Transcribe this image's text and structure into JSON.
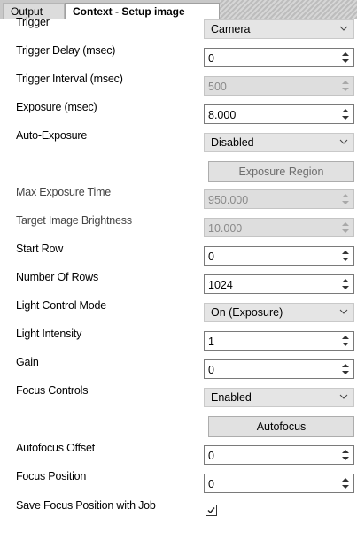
{
  "tabs": {
    "output": "Output",
    "context": "Context - Setup image"
  },
  "fields": {
    "trigger": {
      "label": "Trigger",
      "value": "Camera"
    },
    "trigger_delay": {
      "label": "Trigger Delay (msec)",
      "value": "0"
    },
    "trigger_interval": {
      "label": "Trigger Interval (msec)",
      "value": "500"
    },
    "exposure": {
      "label": "Exposure (msec)",
      "value": "8.000"
    },
    "auto_exposure": {
      "label": "Auto-Exposure",
      "value": "Disabled"
    },
    "exposure_region": {
      "button": "Exposure Region"
    },
    "max_exposure_time": {
      "label": "Max Exposure Time",
      "value": "950.000"
    },
    "target_brightness": {
      "label": "Target Image Brightness",
      "value": "10.000"
    },
    "start_row": {
      "label": "Start Row",
      "value": "0"
    },
    "number_of_rows": {
      "label": "Number Of Rows",
      "value": "1024"
    },
    "light_control_mode": {
      "label": "Light Control Mode",
      "value": "On (Exposure)"
    },
    "light_intensity": {
      "label": "Light Intensity",
      "value": "1"
    },
    "gain": {
      "label": "Gain",
      "value": "0"
    },
    "focus_controls": {
      "label": "Focus Controls",
      "value": "Enabled"
    },
    "autofocus": {
      "button": "Autofocus"
    },
    "autofocus_offset": {
      "label": "Autofocus Offset",
      "value": "0"
    },
    "focus_position": {
      "label": "Focus Position",
      "value": "0"
    },
    "save_focus_position": {
      "label": "Save Focus Position with Job",
      "checked": true
    }
  }
}
